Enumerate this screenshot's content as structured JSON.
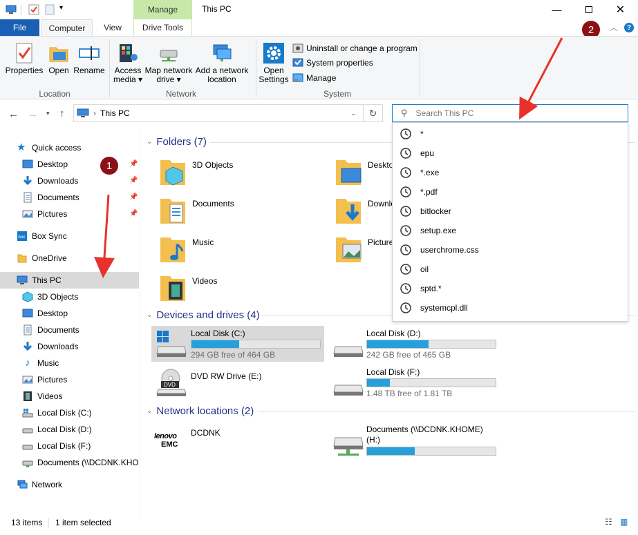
{
  "window": {
    "title": "This PC",
    "contextual_tab_group": "Manage"
  },
  "tabs": [
    {
      "label": "File"
    },
    {
      "label": "Computer"
    },
    {
      "label": "View"
    },
    {
      "label": "Drive Tools"
    }
  ],
  "ribbon": {
    "location": {
      "label": "Location",
      "buttons": [
        {
          "label": "Properties",
          "icon": "properties-icon"
        },
        {
          "label": "Open",
          "icon": "open-icon"
        },
        {
          "label": "Rename",
          "icon": "rename-icon"
        }
      ]
    },
    "network": {
      "label": "Network",
      "access_media_1": "Access",
      "access_media_2": "media ▾",
      "map_drive_1": "Map network",
      "map_drive_2": "drive ▾",
      "add_location_1": "Add a network",
      "add_location_2": "location"
    },
    "system": {
      "label": "System",
      "open_settings_1": "Open",
      "open_settings_2": "Settings",
      "uninstall": "Uninstall or change a program",
      "system_properties": "System properties",
      "manage": "Manage"
    }
  },
  "address": {
    "path": "This PC",
    "search_placeholder": "Search This PC"
  },
  "search_history": [
    "*",
    "epu",
    "*.exe",
    "*.pdf",
    "bitlocker",
    "setup.exe",
    "userchrome.css",
    "oil",
    "sptd.*",
    "systemcpl.dll"
  ],
  "nav": {
    "quick_access": "Quick access",
    "quick_items": [
      "Desktop",
      "Downloads",
      "Documents",
      "Pictures"
    ],
    "box_sync": "Box Sync",
    "onedrive": "OneDrive",
    "this_pc": "This PC",
    "pc_items": [
      "3D Objects",
      "Desktop",
      "Documents",
      "Downloads",
      "Music",
      "Pictures",
      "Videos",
      "Local Disk (C:)",
      "Local Disk (D:)",
      "Local Disk (F:)",
      "Documents (\\\\DCDNK.KHO"
    ],
    "network": "Network"
  },
  "content": {
    "folders_header": "Folders (7)",
    "folders": [
      "3D Objects",
      "Desktop",
      "Documents",
      "Downloads",
      "Music",
      "Pictures",
      "Videos"
    ],
    "devices_header": "Devices and drives (4)",
    "drives": [
      {
        "name": "Local Disk (C:)",
        "free": "294 GB free of 464 GB",
        "used_fraction": 0.37
      },
      {
        "name": "Local Disk (D:)",
        "free": "242 GB free of 465 GB",
        "used_fraction": 0.48
      },
      {
        "name": "DVD RW Drive (E:)",
        "dvd_label": "DVD"
      },
      {
        "name": "Local Disk (F:)",
        "free": "1.48 TB free of 1.81 TB",
        "used_fraction": 0.18
      }
    ],
    "network_header": "Network locations (2)",
    "network_locations": [
      {
        "name": "DCDNK",
        "logo_1": "lenovo",
        "logo_2": "EMC"
      },
      {
        "name_1": "Documents (\\\\DCDNK.KHOME)",
        "name_2": "(H:)",
        "used_fraction": 0.37
      }
    ]
  },
  "status": {
    "items": "13 items",
    "selected": "1 item selected"
  },
  "annotations": {
    "badge_1": "1",
    "badge_2": "2"
  },
  "colors": {
    "accent": "#1979ca",
    "file_tab": "#1a5fb4",
    "manage_tab": "#c7e8a8",
    "drive_fill": "#26a0da",
    "badge": "#8b1114",
    "arrow": "#e8312b",
    "folder": "#f3c04f"
  }
}
